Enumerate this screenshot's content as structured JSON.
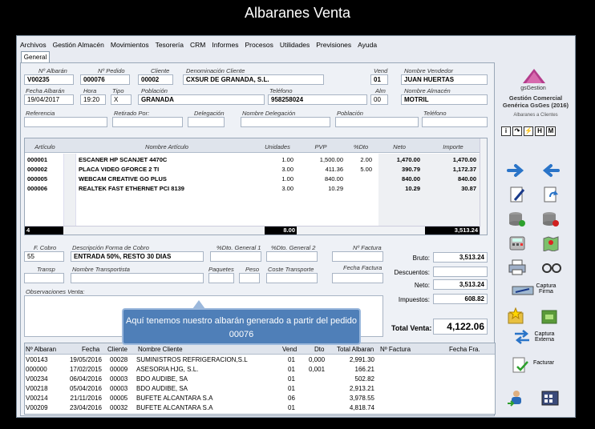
{
  "caption": "Albaranes Venta",
  "menu": [
    "Archivos",
    "Gestión Almacén",
    "Movimientos",
    "Tesorería",
    "CRM",
    "Informes",
    "Procesos",
    "Utilidades",
    "Previsiones",
    "Ayuda"
  ],
  "tab": "General",
  "labels": {
    "num_albaran": "Nº Albarán",
    "num_pedido": "Nº Pedido",
    "cliente": "Cliente",
    "denominacion": "Denominación Cliente",
    "vend": "Vend",
    "nombre_vendedor": "Nombre Vendedor",
    "fecha_albaran": "Fecha Albarán",
    "hora": "Hora",
    "tipo": "Tipo",
    "poblacion": "Población",
    "telefono": "Teléfono",
    "alm": "Alm",
    "nombre_almacen": "Nombre Almacén",
    "referencia": "Referencia",
    "retirado": "Retirado Por:",
    "delegacion": "Delegación",
    "nombre_delegacion": "Nombre Delegación",
    "poblacion2": "Población",
    "telefono2": "Teléfono",
    "f_cobro": "F. Cobro",
    "desc_forma_cobro": "Descripción Forma de Cobro",
    "dto_general1": "%Dto. General 1",
    "dto_general2": "%Dto. General 2",
    "num_factura": "Nº Factura",
    "transp": "Transp",
    "nombre_transportista": "Nombre Transportista",
    "paquetes": "Paquetes",
    "peso": "Peso",
    "coste_transporte": "Coste Transporte",
    "fecha_factura": "Fecha Factura",
    "observaciones": "Observaciones Venta:",
    "bruto": "Bruto:",
    "descuentos": "Descuentos:",
    "neto": "Neto:",
    "impuestos": "Impuestos:",
    "total_venta": "Total Venta:"
  },
  "values": {
    "num_albaran": "V00235",
    "num_pedido": "000076",
    "cliente": "00002",
    "denominacion": "CXSUR DE GRANADA, S.L.",
    "vend": "01",
    "nombre_vendedor": "JUAN HUERTAS",
    "fecha_albaran": "19/04/2017",
    "hora": "19:20",
    "tipo": "X",
    "poblacion": "GRANADA",
    "telefono": "958258024",
    "alm": "00",
    "nombre_almacen": "MOTRIL",
    "f_cobro": "55",
    "desc_forma_cobro": "ENTRADA 50%, RESTO 30 DIAS",
    "bruto": "3,513.24",
    "descuentos": "",
    "neto": "3,513.24",
    "impuestos": "608.82",
    "total_venta": "4,122.06"
  },
  "lines": {
    "headers": [
      "Artículo",
      "Nombre Artículo",
      "Unidades",
      "PVP",
      "%Dto",
      "Neto",
      "Importe"
    ],
    "rows": [
      [
        "000001",
        "ESCANER HP SCANJET 4470C",
        "1.00",
        "1,500.00",
        "2.00",
        "1,470.00",
        "1,470.00"
      ],
      [
        "000002",
        "PLACA VIDEO GFORCE 2 TI",
        "3.00",
        "411.36",
        "5.00",
        "390.79",
        "1,172.37"
      ],
      [
        "000005",
        "WEBCAM CREATIVE GO PLUS",
        "1.00",
        "840.00",
        "",
        "840.00",
        "840.00"
      ],
      [
        "000006",
        "REALTEK FAST ETHERNET PCI 8139",
        "3.00",
        "10.29",
        "",
        "10.29",
        "30.87"
      ]
    ],
    "count": "4",
    "total_units": "8.00",
    "total_importe": "3,513.24"
  },
  "list": {
    "headers": [
      "Nº Albaran",
      "Fecha",
      "Cliente",
      "Nombre Cliente",
      "Vend",
      "Dto",
      "Total Albaran",
      "Nº Factura",
      "Fecha Fra."
    ],
    "rows": [
      [
        "V00143",
        "19/05/2016",
        "00028",
        "SUMINISTROS REFRIGERACION,S.L",
        "01",
        "0,000",
        "2,991.30",
        "",
        ""
      ],
      [
        "000000",
        "17/02/2015",
        "00009",
        "ASESORIA HJG, S.L.",
        "01",
        "0,001",
        "166.21",
        "",
        ""
      ],
      [
        "V00234",
        "06/04/2016",
        "00003",
        "BDO AUDIBE, SA",
        "01",
        "",
        "502.82",
        "",
        ""
      ],
      [
        "V00218",
        "05/04/2016",
        "00003",
        "BDO AUDIBE, SA",
        "01",
        "",
        "2,913.21",
        "",
        ""
      ],
      [
        "V00214",
        "21/11/2016",
        "00005",
        "BUFETE ALCANTARA S.A",
        "06",
        "",
        "3,978.55",
        "",
        ""
      ],
      [
        "V00209",
        "23/04/2016",
        "00032",
        "BUFETE ALCANTARA S.A",
        "01",
        "",
        "4,818.74",
        "",
        ""
      ]
    ]
  },
  "callout": "Aquí tenemos nuestro albarán generado a partir del pedido 00076",
  "brand": {
    "name": "gsGestion",
    "line1": "Gestión Comercial",
    "line2": "Genérica GsGes (2016)",
    "line3": "Albaranes a Clientes"
  },
  "small_icons": [
    "i",
    "↷",
    "⚡",
    "H",
    "M"
  ],
  "actions": {
    "captura_firma": "Captura Firma",
    "captura_externa": "Captura Externa",
    "facturar": "Facturar"
  },
  "colors": {
    "accent": "#4f7fb8",
    "brand": "#b43c8c"
  }
}
